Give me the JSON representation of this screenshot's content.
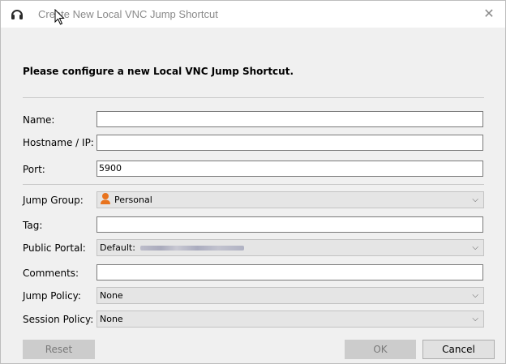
{
  "window": {
    "title": "Create New Local VNC Jump Shortcut",
    "close_glyph": "✕"
  },
  "heading": "Please configure a new Local VNC Jump Shortcut.",
  "fields": {
    "name": {
      "label": "Name:",
      "value": ""
    },
    "hostname": {
      "label": "Hostname / IP:",
      "value": ""
    },
    "port": {
      "label": "Port:",
      "value": "5900"
    },
    "jump_group": {
      "label": "Jump Group:",
      "value": "Personal",
      "icon": "person-icon"
    },
    "tag": {
      "label": "Tag:",
      "value": ""
    },
    "public_portal": {
      "label": "Public Portal:",
      "value": "Default:"
    },
    "comments": {
      "label": "Comments:",
      "value": ""
    },
    "jump_policy": {
      "label": "Jump Policy:",
      "value": "None"
    },
    "session_policy": {
      "label": "Session Policy:",
      "value": "None"
    }
  },
  "buttons": {
    "reset": "Reset",
    "ok": "OK",
    "cancel": "Cancel"
  },
  "colors": {
    "accent_person": "#e8731e",
    "body_bg": "#f0f0f0"
  }
}
